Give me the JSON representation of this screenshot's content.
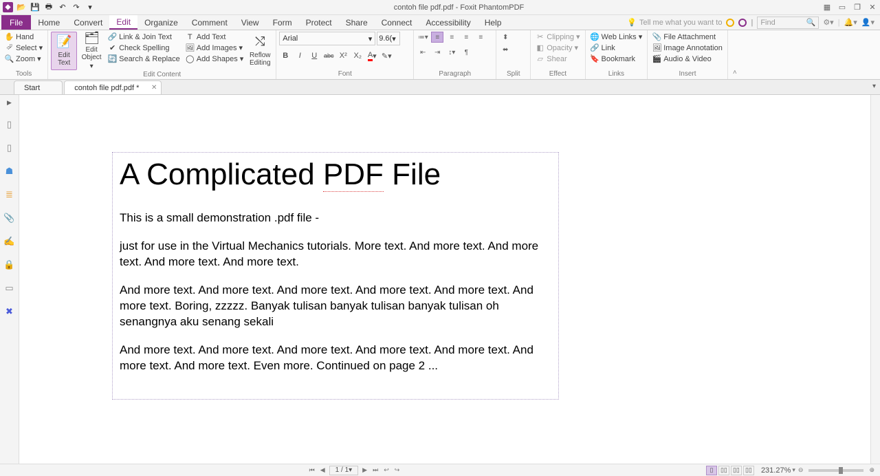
{
  "titlebar": {
    "title": "contoh file pdf.pdf - Foxit PhantomPDF"
  },
  "menu": {
    "file": "File",
    "tabs": [
      "Home",
      "Convert",
      "Edit",
      "Organize",
      "Comment",
      "View",
      "Form",
      "Protect",
      "Share",
      "Connect",
      "Accessibility",
      "Help"
    ],
    "active": "Edit",
    "tell_me": "Tell me what you want to",
    "find": "Find"
  },
  "ribbon": {
    "tools": {
      "label": "Tools",
      "hand": "Hand",
      "select": "Select",
      "zoom": "Zoom"
    },
    "edit_content": {
      "label": "Edit Content",
      "edit_text": "Edit Text",
      "edit_object": "Edit Object",
      "link_join": "Link & Join Text",
      "check_spelling": "Check Spelling",
      "search_replace": "Search & Replace",
      "add_text": "Add Text",
      "add_images": "Add Images",
      "add_shapes": "Add Shapes",
      "reflow": "Reflow Editing"
    },
    "font": {
      "label": "Font",
      "name": "Arial",
      "size": "9.6("
    },
    "paragraph": {
      "label": "Paragraph"
    },
    "split": {
      "label": "Split"
    },
    "effect": {
      "label": "Effect",
      "clipping": "Clipping",
      "opacity": "Opacity",
      "shear": "Shear"
    },
    "links": {
      "label": "Links",
      "web_links": "Web Links",
      "link": "Link",
      "bookmark": "Bookmark"
    },
    "insert": {
      "label": "Insert",
      "file_attachment": "File Attachment",
      "image_annotation": "Image Annotation",
      "audio_video": "Audio & Video"
    }
  },
  "doctabs": {
    "start": "Start",
    "doc": "contoh file pdf.pdf *"
  },
  "document": {
    "title": "A Complicated PDF File",
    "p1": "This is a small demonstration .pdf file -",
    "p2": "just for use in the Virtual Mechanics tutorials. More text. And more text. And more text. And more text. And more text.",
    "p3": "And more text. And more text. And more text. And more text. And more text. And more text. Boring, zzzzz. Banyak tulisan banyak tulisan banyak tulisan oh senangnya aku senang sekali",
    "p4": "And more text. And more text. And more text. And more text. And more text. And more text. And more text. Even more. Continued on page 2 ..."
  },
  "status": {
    "page": "1 / 1",
    "zoom": "231.27%"
  }
}
